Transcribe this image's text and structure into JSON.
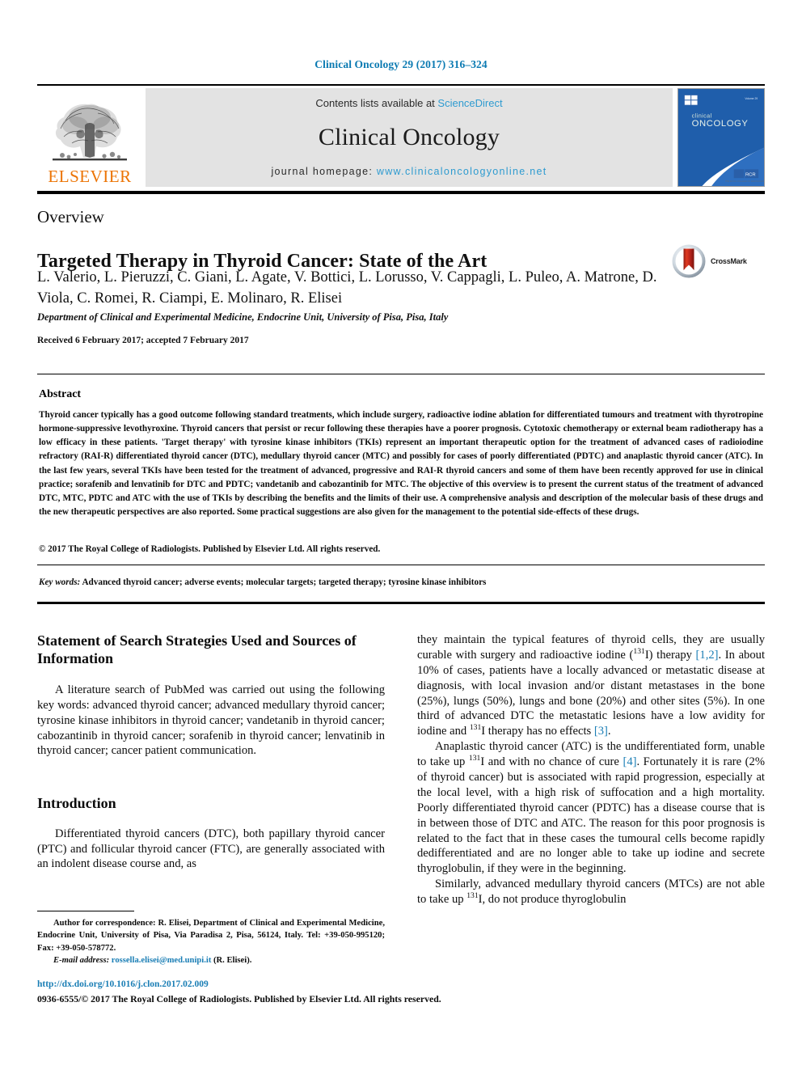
{
  "running_head": "Clinical Oncology 29 (2017) 316–324",
  "masthead": {
    "publisher_name": "ELSEVIER",
    "publisher_logo_alt": "elsevier-tree-logo",
    "contents_prefix": "Contents lists available at ",
    "contents_link": "ScienceDirect",
    "journal_title": "Clinical Oncology",
    "homepage_prefix": "journal homepage: ",
    "homepage_link": "www.clinicaloncologyonline.net",
    "cover_line1": "clinical",
    "cover_line2": "ONCOLOGY"
  },
  "article": {
    "type": "Overview",
    "title": "Targeted Therapy in Thyroid Cancer: State of the Art",
    "authors": "L. Valerio, L. Pieruzzi, C. Giani, L. Agate, V. Bottici, L. Lorusso, V. Cappagli, L. Puleo, A. Matrone, D. Viola, C. Romei, R. Ciampi, E. Molinaro, R. Elisei",
    "affiliation": "Department of Clinical and Experimental Medicine, Endocrine Unit, University of Pisa, Pisa, Italy",
    "dates": "Received 6 February 2017; accepted 7 February 2017",
    "crossmark_label": "CrossMark"
  },
  "abstract": {
    "heading": "Abstract",
    "body": "Thyroid cancer typically has a good outcome following standard treatments, which include surgery, radioactive iodine ablation for differentiated tumours and treatment with thyrotropine hormone-suppressive levothyroxine. Thyroid cancers that persist or recur following these therapies have a poorer prognosis. Cytotoxic chemotherapy or external beam radiotherapy has a low efficacy in these patients. 'Target therapy' with tyrosine kinase inhibitors (TKIs) represent an important therapeutic option for the treatment of advanced cases of radioiodine refractory (RAI-R) differentiated thyroid cancer (DTC), medullary thyroid cancer (MTC) and possibly for cases of poorly differentiated (PDTC) and anaplastic thyroid cancer (ATC). In the last few years, several TKIs have been tested for the treatment of advanced, progressive and RAI-R thyroid cancers and some of them have been recently approved for use in clinical practice; sorafenib and lenvatinib for DTC and PDTC; vandetanib and cabozantinib for MTC. The objective of this overview is to present the current status of the treatment of advanced DTC, MTC, PDTC and ATC with the use of TKIs by describing the benefits and the limits of their use. A comprehensive analysis and description of the molecular basis of these drugs and the new therapeutic perspectives are also reported. Some practical suggestions are also given for the management to the potential side-effects of these drugs.",
    "copyright": "© 2017 The Royal College of Radiologists. Published by Elsevier Ltd. All rights reserved.",
    "keywords_label": "Key words:",
    "keywords_value": " Advanced thyroid cancer; adverse events; molecular targets; targeted therapy; tyrosine kinase inhibitors"
  },
  "left_column": {
    "search_heading": "Statement of Search Strategies Used and Sources of Information",
    "search_para": "A literature search of PubMed was carried out using the following key words: advanced thyroid cancer; advanced medullary thyroid cancer; tyrosine kinase inhibitors in thyroid cancer; vandetanib in thyroid cancer; cabozantinib in thyroid cancer; sorafenib in thyroid cancer; lenvatinib in thyroid cancer; cancer patient communication.",
    "intro_heading": "Introduction",
    "intro_para": "Differentiated thyroid cancers (DTC), both papillary thyroid cancer (PTC) and follicular thyroid cancer (FTC), are generally associated with an indolent disease course and, as"
  },
  "right_column": {
    "p1_a": "they maintain the typical features of thyroid cells, they are usually curable with surgery and radioactive iodine (",
    "p1_sup1": "131",
    "p1_b": "I) therapy ",
    "p1_ref1": "[1,2]",
    "p1_c": ". In about 10% of cases, patients have a locally advanced or metastatic disease at diagnosis, with local invasion and/or distant metastases in the bone (25%), lungs (50%), lungs and bone (20%) and other sites (5%). In one third of advanced DTC the metastatic lesions have a low avidity for iodine and ",
    "p1_sup2": "131",
    "p1_d": "I therapy has no effects ",
    "p1_ref2": "[3]",
    "p1_e": ".",
    "p2_a": "Anaplastic thyroid cancer (ATC) is the undifferentiated form, unable to take up ",
    "p2_sup1": "131",
    "p2_b": "I and with no chance of cure ",
    "p2_ref1": "[4]",
    "p2_c": ". Fortunately it is rare (2% of thyroid cancer) but is associated with rapid progression, especially at the local level, with a high risk of suffocation and a high mortality. Poorly differentiated thyroid cancer (PDTC) has a disease course that is in between those of DTC and ATC. The reason for this poor prognosis is related to the fact that in these cases the tumoural cells become rapidly dedifferentiated and are no longer able to take up iodine and secrete thyroglobulin, if they were in the beginning.",
    "p3_a": "Similarly, advanced medullary thyroid cancers (MTCs) are not able to take up ",
    "p3_sup1": "131",
    "p3_b": "I, do not produce thyroglobulin"
  },
  "footnote": {
    "correspondence": "Author for correspondence: R. Elisei, Department of Clinical and Experimental Medicine, Endocrine Unit, University of Pisa, Via Paradisa 2, Pisa, 56124, Italy. Tel: +39-050-995120; Fax: +39-050-578772.",
    "email_label": "E-mail address:",
    "email_value": " rossella.elisei@med.unipi.it",
    "email_suffix": " (R. Elisei)."
  },
  "page_footer": {
    "doi": "http://dx.doi.org/10.1016/j.clon.2017.02.009",
    "issn_line": "0936-6555/© 2017 The Royal College of Radiologists. Published by Elsevier Ltd. All rights reserved."
  },
  "colors": {
    "link_blue": "#2e9bd0",
    "head_blue": "#0b7ab2",
    "ref_blue": "#1a7eb5",
    "elsevier_orange": "#ec7404",
    "banner_grey": "#e3e3e3",
    "cover_blue": "#1f5eab"
  }
}
